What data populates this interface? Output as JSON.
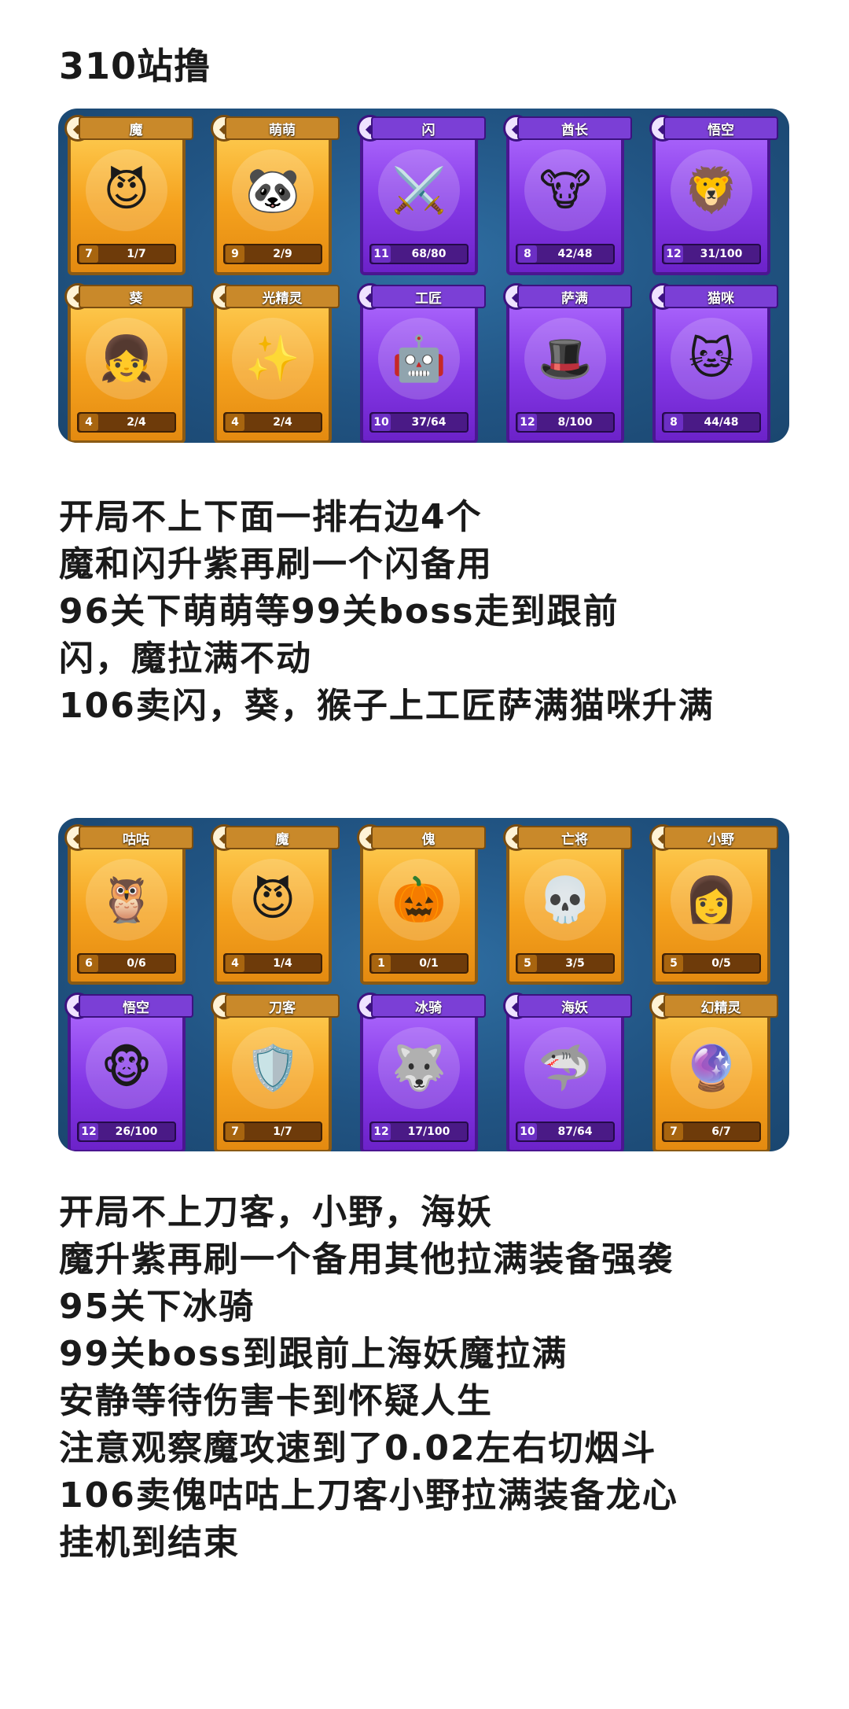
{
  "heading": "310站撸",
  "panel1": [
    {
      "name": "魔",
      "level": "7",
      "progress": "1/7",
      "rarity": "gold",
      "icon": "😈"
    },
    {
      "name": "萌萌",
      "level": "9",
      "progress": "2/9",
      "rarity": "gold",
      "icon": "🐼"
    },
    {
      "name": "闪",
      "level": "11",
      "progress": "68/80",
      "rarity": "purple",
      "icon": "⚔️"
    },
    {
      "name": "酋长",
      "level": "8",
      "progress": "42/48",
      "rarity": "purple",
      "icon": "🐮"
    },
    {
      "name": "悟空",
      "level": "12",
      "progress": "31/100",
      "rarity": "purple",
      "icon": "🦁"
    },
    {
      "name": "葵",
      "level": "4",
      "progress": "2/4",
      "rarity": "gold",
      "icon": "👧"
    },
    {
      "name": "光精灵",
      "level": "4",
      "progress": "2/4",
      "rarity": "gold",
      "icon": "✨"
    },
    {
      "name": "工匠",
      "level": "10",
      "progress": "37/64",
      "rarity": "purple",
      "icon": "🤖"
    },
    {
      "name": "萨满",
      "level": "12",
      "progress": "8/100",
      "rarity": "purple",
      "icon": "🎩"
    },
    {
      "name": "猫咪",
      "level": "8",
      "progress": "44/48",
      "rarity": "purple",
      "icon": "🐱"
    }
  ],
  "text1": [
    "开局不上下面一排右边4个",
    "魔和闪升紫再刷一个闪备用",
    "96关下萌萌等99关boss走到跟前",
    "闪，魔拉满不动",
    "106卖闪，葵，猴子上工匠萨满猫咪升满"
  ],
  "panel2": [
    {
      "name": "咕咕",
      "level": "6",
      "progress": "0/6",
      "rarity": "gold",
      "icon": "🦉"
    },
    {
      "name": "魔",
      "level": "4",
      "progress": "1/4",
      "rarity": "gold",
      "icon": "😈"
    },
    {
      "name": "傀",
      "level": "1",
      "progress": "0/1",
      "rarity": "gold",
      "icon": "🎃"
    },
    {
      "name": "亡将",
      "level": "5",
      "progress": "3/5",
      "rarity": "gold",
      "icon": "💀"
    },
    {
      "name": "小野",
      "level": "5",
      "progress": "0/5",
      "rarity": "gold",
      "icon": "👩"
    },
    {
      "name": "悟空",
      "level": "12",
      "progress": "26/100",
      "rarity": "purple",
      "icon": "🐵"
    },
    {
      "name": "刀客",
      "level": "7",
      "progress": "1/7",
      "rarity": "gold",
      "icon": "🛡️"
    },
    {
      "name": "冰骑",
      "level": "12",
      "progress": "17/100",
      "rarity": "purple",
      "icon": "🐺"
    },
    {
      "name": "海妖",
      "level": "10",
      "progress": "87/64",
      "rarity": "purple",
      "icon": "🦈"
    },
    {
      "name": "幻精灵",
      "level": "7",
      "progress": "6/7",
      "rarity": "gold",
      "icon": "🔮"
    }
  ],
  "text2": [
    "开局不上刀客，小野，海妖",
    "魔升紫再刷一个备用其他拉满装备强袭",
    "95关下冰骑",
    "99关boss到跟前上海妖魔拉满",
    "安静等待伤害卡到怀疑人生",
    "注意观察魔攻速到了0.02左右切烟斗",
    "106卖傀咕咕上刀客小野拉满装备龙心",
    "挂机到结束"
  ]
}
